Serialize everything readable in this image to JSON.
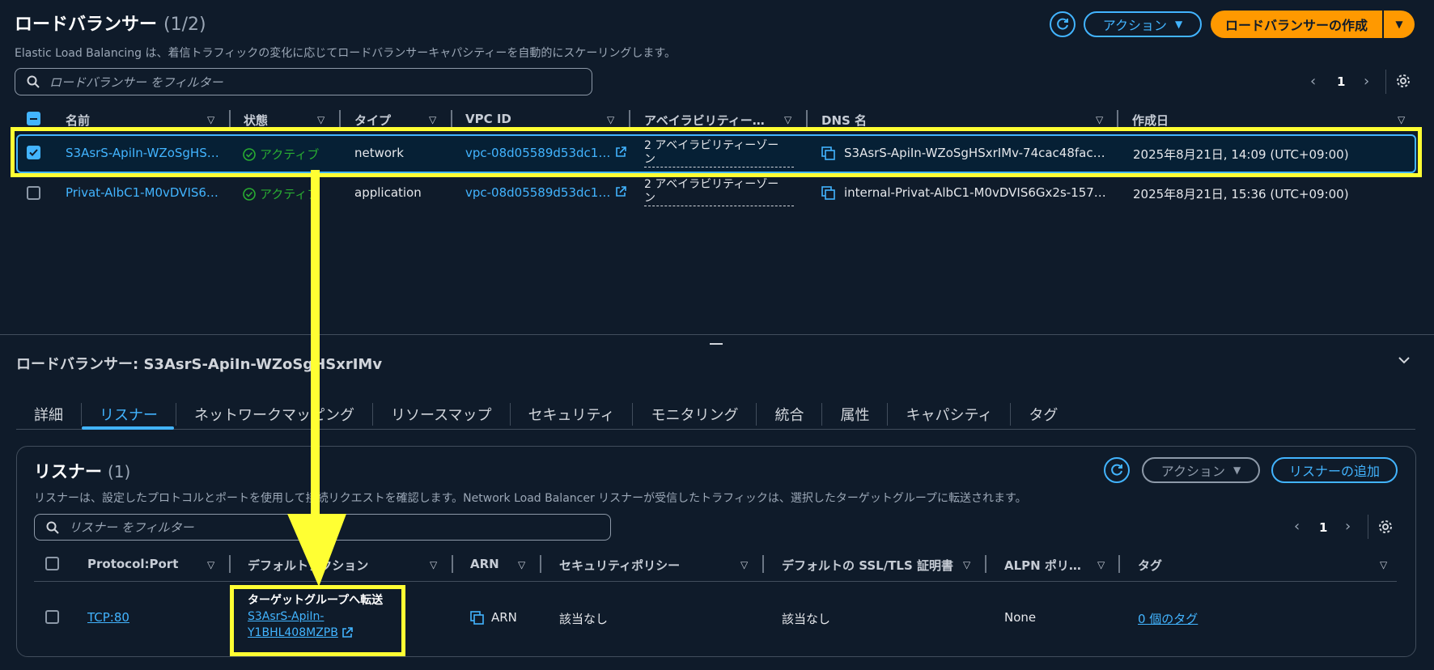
{
  "top": {
    "title": "ロードバランサー",
    "count": "(1/2)",
    "description": "Elastic Load Balancing は、着信トラフィックの変化に応じてロードバランサーキャパシティーを自動的にスケーリングします。",
    "actions_label": "アクション",
    "create_label": "ロードバランサーの作成",
    "search_placeholder": "ロードバランサー をフィルター",
    "page_number": "1"
  },
  "lb_table": {
    "headers": [
      "名前",
      "状態",
      "タイプ",
      "VPC ID",
      "アベイラビリティー…",
      "DNS 名",
      "作成日"
    ],
    "rows": [
      {
        "name": "S3AsrS-ApiIn-WZoSgHS…",
        "state": "アクティブ",
        "type": "network",
        "vpc": "vpc-08d05589d53dc10…",
        "az_line1": "2 アベイラビリティーゾー",
        "az_line2": "ン",
        "dns": "S3AsrS-ApiIn-WZoSgHSxrIMv-74cac48fac5f…",
        "created": "2025年8月21日, 14:09 (UTC+09:00)",
        "selected": true
      },
      {
        "name": "Privat-AlbC1-M0vDVIS6…",
        "state": "アクティブ",
        "type": "application",
        "vpc": "vpc-08d05589d53dc10…",
        "az_line1": "2 アベイラビリティーゾー",
        "az_line2": "ン",
        "dns": "internal-Privat-AlbC1-M0vDVIS6Gx2s-1571…",
        "created": "2025年8月21日, 15:36 (UTC+09:00)",
        "selected": false
      }
    ]
  },
  "detail": {
    "title": "ロードバランサー: S3AsrS-ApiIn-WZoSgHSxrIMv",
    "tabs": [
      "詳細",
      "リスナー",
      "ネットワークマッピング",
      "リソースマップ",
      "セキュリティ",
      "モニタリング",
      "統合",
      "属性",
      "キャパシティ",
      "タグ"
    ],
    "active_tab": "リスナー"
  },
  "listeners": {
    "title": "リスナー",
    "count": "(1)",
    "description": "リスナーは、設定したプロトコルとポートを使用して接続リクエストを確認します。Network Load Balancer リスナーが受信したトラフィックは、選択したターゲットグループに転送されます。",
    "actions_label": "アクション",
    "add_label": "リスナーの追加",
    "search_placeholder": "リスナー をフィルター",
    "page_number": "1",
    "headers": [
      "Protocol:Port",
      "デフォルトアクション",
      "ARN",
      "セキュリティポリシー",
      "デフォルトの SSL/TLS 証明書",
      "ALPN ポリ…",
      "タグ"
    ],
    "row": {
      "port": "TCP:80",
      "action_title": "ターゲットグループへ転送",
      "target_line1": "S3AsrS-ApiIn-",
      "target_line2": "Y1BHL408MZPB",
      "arn": "ARN",
      "policy": "該当なし",
      "cert": "該当なし",
      "alpn": "None",
      "tags": "0 個のタグ"
    }
  },
  "colors": {
    "background": "#0f1b2a",
    "link": "#42b4ff",
    "primary": "#ff9900",
    "highlight": "#ffff33",
    "success": "#29ad32"
  }
}
